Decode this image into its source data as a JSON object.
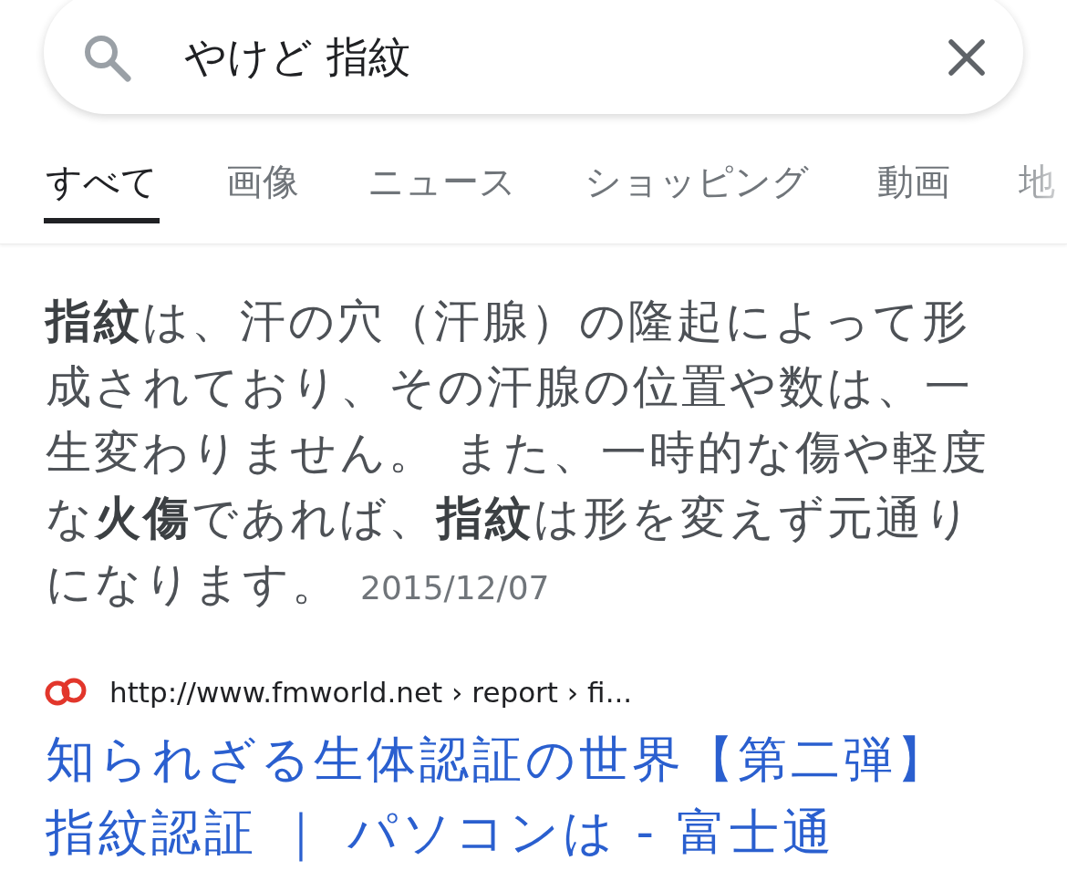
{
  "search": {
    "value": "やけど 指紋"
  },
  "tabs": [
    {
      "label": "すべて",
      "selected": true
    },
    {
      "label": "画像",
      "selected": false
    },
    {
      "label": "ニュース",
      "selected": false
    },
    {
      "label": "ショッピング",
      "selected": false
    },
    {
      "label": "動画",
      "selected": false
    },
    {
      "label": "地",
      "selected": false
    }
  ],
  "featured_snippet": {
    "text": "**指紋**は、汗の穴（汗腺）の隆起によって形成されており、その汗腺の位置や数は、一生変わりません。 また、一時的な傷や軽度な**火傷**であれば、**指紋**は形を変えず元通りになります。",
    "date": "2015/12/07"
  },
  "result": {
    "url": "http://www.fmworld.net › report › fi...",
    "title": "知られざる生体認証の世界【第二弾】指紋認証 ｜ パソコンは - 富士通"
  }
}
